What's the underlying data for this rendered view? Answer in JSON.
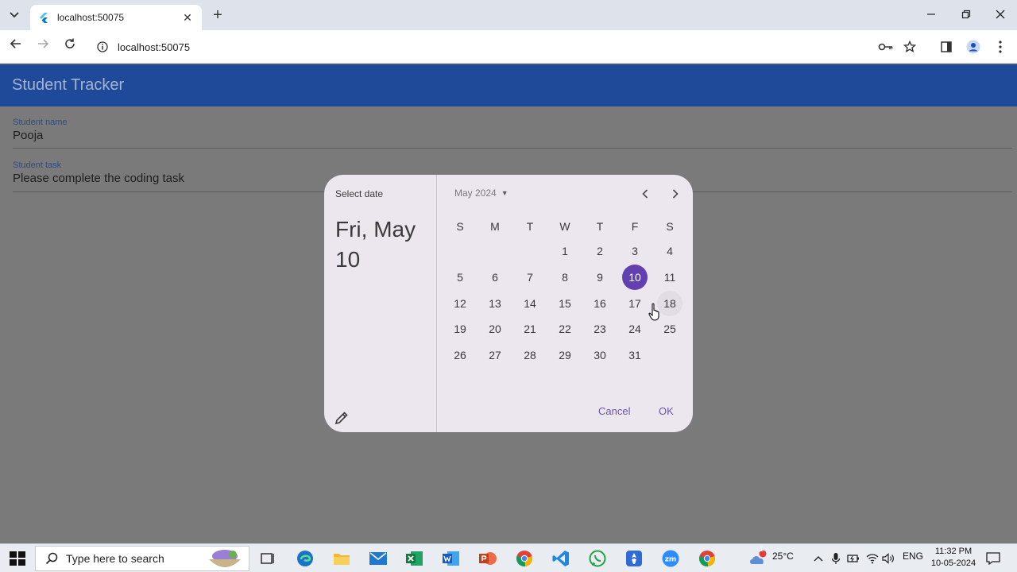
{
  "browser": {
    "tab_title": "localhost:50075",
    "address": "localhost:50075"
  },
  "app": {
    "title": "Student Tracker",
    "fields": [
      {
        "label": "Student name",
        "value": "Pooja"
      },
      {
        "label": "Student task",
        "value": "Please complete the coding task"
      }
    ]
  },
  "date_picker": {
    "help_text": "Select date",
    "headline": "Fri, May 10",
    "month_label": "May 2024",
    "weekdays": [
      "S",
      "M",
      "T",
      "W",
      "T",
      "F",
      "S"
    ],
    "weeks": [
      [
        "",
        "",
        "",
        "1",
        "2",
        "3",
        "4"
      ],
      [
        "5",
        "6",
        "7",
        "8",
        "9",
        "10",
        "11"
      ],
      [
        "12",
        "13",
        "14",
        "15",
        "16",
        "17",
        "18"
      ],
      [
        "19",
        "20",
        "21",
        "22",
        "23",
        "24",
        "25"
      ],
      [
        "26",
        "27",
        "28",
        "29",
        "30",
        "31",
        ""
      ]
    ],
    "selected_day": "10",
    "hovered_day": "18",
    "cancel_label": "Cancel",
    "ok_label": "OK",
    "accent_color": "#6340b0"
  },
  "taskbar": {
    "search_placeholder": "Type here to search",
    "weather": "25°C",
    "weather_badge": "1",
    "language": "ENG",
    "time": "11:32 PM",
    "date": "10-05-2024"
  }
}
